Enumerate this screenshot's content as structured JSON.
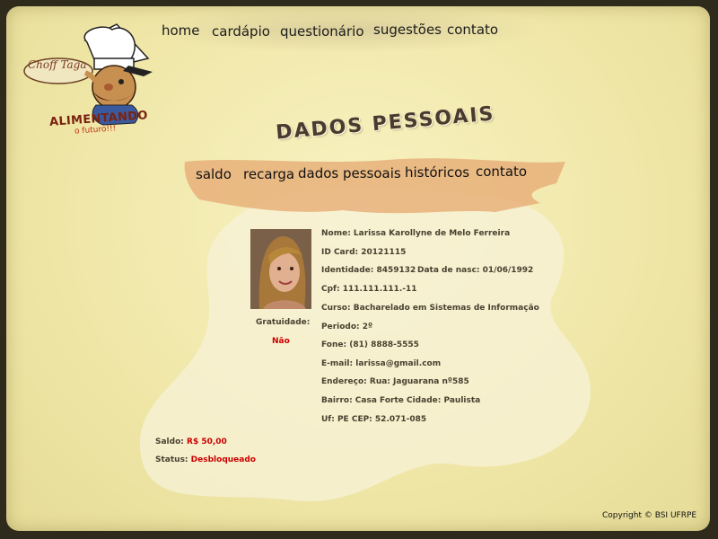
{
  "logo": {
    "script_text": "Choff Taga",
    "brand": "ALIMENTANDO",
    "tagline": "o futuro!!!"
  },
  "top_nav": {
    "items": [
      "home",
      "cardápio",
      "questionário",
      "sugestões",
      "contato"
    ]
  },
  "page_title": "DADOS PESSOAIS",
  "sub_nav": {
    "items": [
      "saldo",
      "recarga",
      "dados pessoais",
      "históricos",
      "contato"
    ]
  },
  "profile": {
    "gratuidade_label": "Gratuidade:",
    "gratuidade_value": "Não",
    "nome": "Nome: Larissa Karollyne de Melo Ferreira",
    "id_card": "ID Card: 20121115",
    "identidade": "Identidade: 8459132",
    "data_nasc": "Data de nasc: 01/06/1992",
    "cpf": "Cpf: 111.111.111.-11",
    "curso": "Curso: Bacharelado em Sistemas de Informação",
    "periodo": "Periodo: 2º",
    "fone": "Fone: (81) 8888-5555",
    "email": "E-mail: larissa@gmail.com",
    "endereco": "Endereço: Rua: Jaguarana nº585",
    "bairro": "Bairro: Casa Forte Cidade: Paulista",
    "uf": "Uf: PE CEP: 52.071-085"
  },
  "account": {
    "saldo_label": "Saldo:",
    "saldo_value": "R$ 50,00",
    "status_label": "Status:",
    "status_value": "Desbloqueado"
  },
  "footer": {
    "copyright": "Copyright © BSI UFRPE"
  },
  "colors": {
    "background": "#f3ecb0",
    "frame": "#2e2a1c",
    "brush": "#e8b07a",
    "accent_red": "#cc0000"
  }
}
